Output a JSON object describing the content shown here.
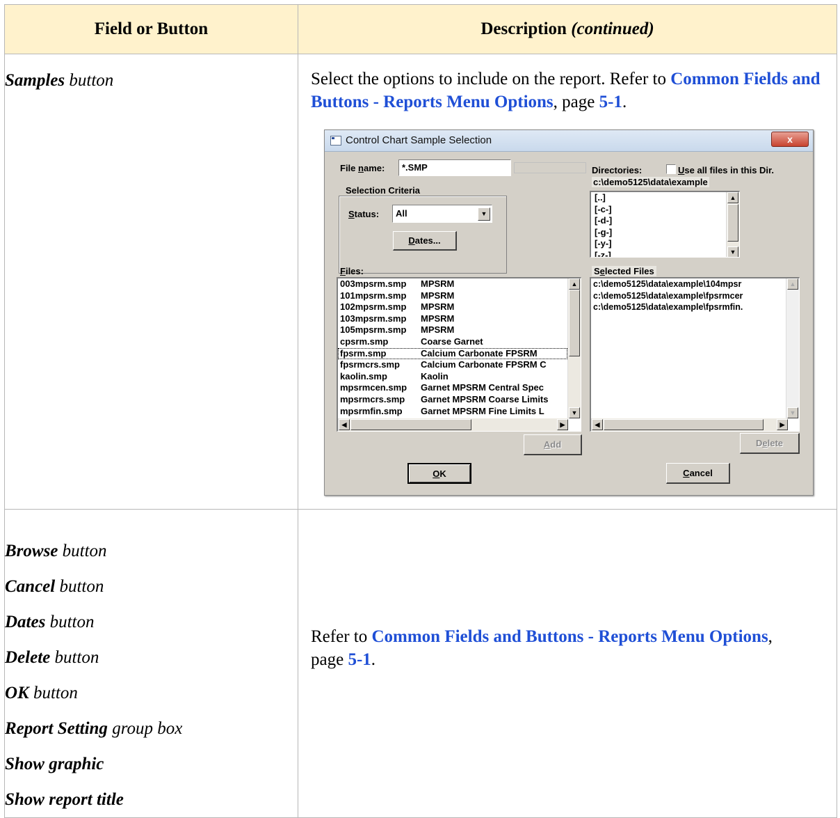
{
  "table": {
    "header": {
      "col1": "Field or Button",
      "col2_main": "Description",
      "col2_cont": "(continued)"
    },
    "row1": {
      "field_bold": "Samples",
      "field_rest": "button",
      "desc_pre": "Select the options to include on the report. Refer to",
      "desc_link": "Common Fields and Buttons - Reports Menu Options",
      "desc_mid": ", page",
      "desc_page": "5-1",
      "desc_end": "."
    },
    "row2": {
      "fields": [
        {
          "bold": "Browse",
          "rest": "button"
        },
        {
          "bold": "Cancel",
          "rest": "button"
        },
        {
          "bold": "Dates",
          "rest": "button"
        },
        {
          "bold": "Delete",
          "rest": "button"
        },
        {
          "bold": "OK",
          "rest": "button"
        },
        {
          "bold": "Report Setting",
          "rest": "group box"
        },
        {
          "bold": "Show graphic",
          "rest": ""
        },
        {
          "bold": "Show report title",
          "rest": ""
        }
      ],
      "desc_pre": "Refer to",
      "desc_link": "Common Fields and Buttons - Reports Menu Options",
      "desc_mid": ", page",
      "desc_page": "5-1",
      "desc_end": "."
    }
  },
  "dialog": {
    "title": "Control Chart Sample Selection",
    "close": "x",
    "file_name_label": "File name:",
    "file_name_value": "*.SMP",
    "directories_label": "Directories:",
    "use_all_files": "Use all files in this Dir.",
    "current_dir": "c:\\demo5125\\data\\example",
    "selection_criteria": "Selection Criteria",
    "status_label": "Status:",
    "status_value": "All",
    "dates_button": "Dates...",
    "directory_items": [
      "[..]",
      "[-c-]",
      "[-d-]",
      "[-g-]",
      "[-y-]",
      "[-z-]"
    ],
    "files_label": "Files:",
    "selected_files_label": "Selected Files",
    "files": [
      {
        "name": "003mpsrm.smp",
        "desc": "MPSRM"
      },
      {
        "name": "101mpsrm.smp",
        "desc": "MPSRM"
      },
      {
        "name": "102mpsrm.smp",
        "desc": "MPSRM"
      },
      {
        "name": "103mpsrm.smp",
        "desc": "MPSRM"
      },
      {
        "name": "105mpsrm.smp",
        "desc": "MPSRM"
      },
      {
        "name": "cpsrm.smp",
        "desc": "Coarse Garnet"
      },
      {
        "name": "fpsrm.smp",
        "desc": "Calcium Carbonate FPSRM"
      },
      {
        "name": "fpsrmcrs.smp",
        "desc": "Calcium Carbonate FPSRM C"
      },
      {
        "name": "kaolin.smp",
        "desc": "Kaolin"
      },
      {
        "name": "mpsrmcen.smp",
        "desc": "Garnet MPSRM Central Spec"
      },
      {
        "name": "mpsrmcrs.smp",
        "desc": "Garnet MPSRM Coarse Limits"
      },
      {
        "name": "mpsrmfin.smp",
        "desc": "Garnet MPSRM Fine Limits L"
      }
    ],
    "selected_files": [
      "c:\\demo5125\\data\\example\\104mpsr",
      "c:\\demo5125\\data\\example\\fpsrmcer",
      "c:\\demo5125\\data\\example\\fpsrmfin."
    ],
    "add_button": "Add",
    "delete_button": "Delete",
    "ok_button": "OK",
    "cancel_button": "Cancel"
  }
}
